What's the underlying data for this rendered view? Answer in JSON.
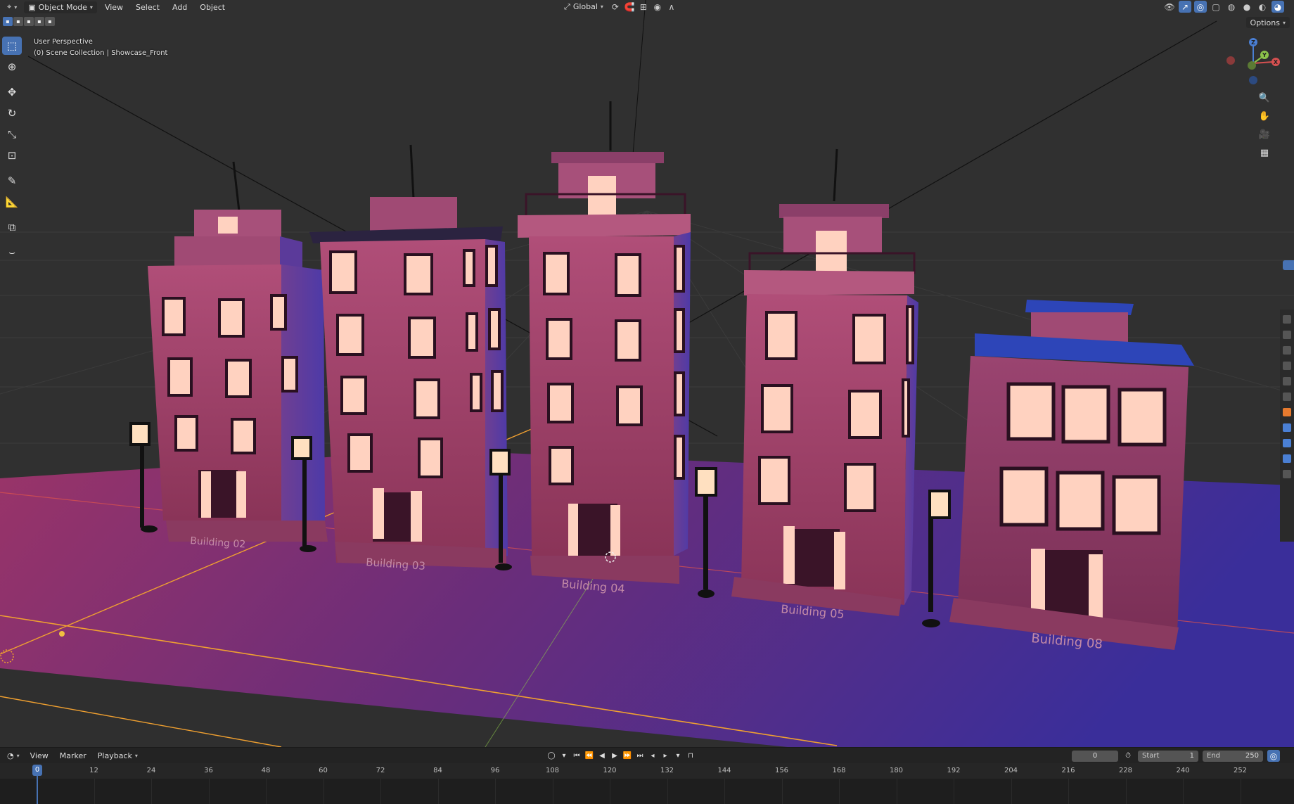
{
  "header": {
    "editor_icon": "3d-viewport-icon",
    "mode": "Object Mode",
    "menus": [
      "View",
      "Select",
      "Add",
      "Object"
    ],
    "transform_orientation": "Global"
  },
  "viewport": {
    "perspective": "User Perspective",
    "collection": "(0) Scene Collection | Showcase_Front",
    "options_label": "Options",
    "gizmo_axes": [
      "X",
      "Y",
      "Z"
    ]
  },
  "scene": {
    "building_labels": [
      "Building 02",
      "Building 03",
      "Building 04",
      "Building 05",
      "Building 08"
    ],
    "colors": {
      "background": "#303030",
      "ground_pink": "#a33a73",
      "ground_blue": "#3a2e9a",
      "window_glow": "#ffd2c0",
      "roof_blue": "#2d45b8",
      "x_axis": "#d65050",
      "y_axis": "#8bc34a",
      "selection_orange": "#f0a030"
    }
  },
  "toolbar": {
    "tools": [
      "select-box-icon",
      "cursor-icon",
      "move-icon",
      "rotate-icon",
      "scale-icon",
      "transform-icon",
      "annotate-icon",
      "measure-icon",
      "add-cube-icon",
      "curve-icon"
    ]
  },
  "timeline": {
    "menus": [
      "View",
      "Marker",
      "Playback"
    ],
    "current_frame": "0",
    "start_label": "Start",
    "start_value": "1",
    "end_label": "End",
    "end_value": "250",
    "ruler_ticks": [
      "0",
      "12",
      "24",
      "36",
      "48",
      "60",
      "72",
      "84",
      "96",
      "108",
      "120",
      "132",
      "144",
      "156",
      "168",
      "180",
      "192",
      "204",
      "216",
      "228",
      "240",
      "252"
    ]
  }
}
